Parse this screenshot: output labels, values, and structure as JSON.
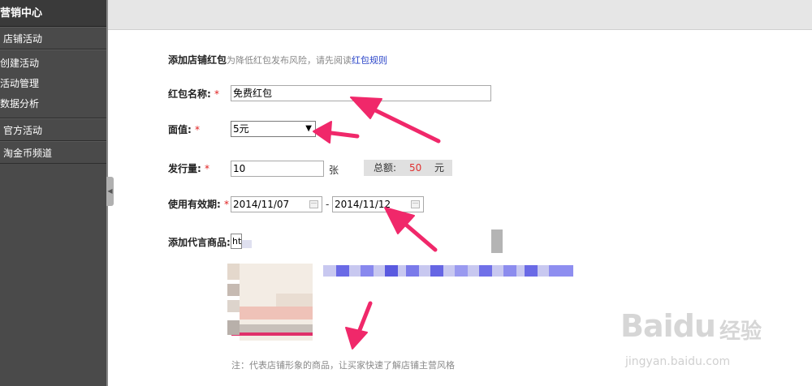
{
  "sidebar": {
    "title": "营销中心",
    "section1": "店铺活动",
    "items": [
      "创建活动",
      "活动管理",
      "数据分析"
    ],
    "section2": "官方活动",
    "section3": "淘金币频道"
  },
  "form": {
    "heading": "添加店铺红包",
    "heading_hint": "为降低红包发布风险，请先阅读",
    "rules_link": "红包规则",
    "name_label": "红包名称:",
    "name_value": "免费红包",
    "face_label": "面值:",
    "face_value": "5元",
    "qty_label": "发行量:",
    "qty_value": "10",
    "qty_unit": "张",
    "total_label": "总额:",
    "total_value": "50",
    "total_unit": "元",
    "validity_label": "使用有效期:",
    "start_date": "2014/11/07",
    "date_sep": "-",
    "end_date": "2014/11/12",
    "product_label": "添加代言商品:",
    "product_value": "ht",
    "required_mark": "*",
    "note": "注：代表店铺形象的商品，让买家快速了解店铺主营风格"
  },
  "watermark": {
    "logo": "Baidu",
    "cn": "经验",
    "url": "jingyan.baidu.com"
  },
  "colors": {
    "accent_link": "#2b45c8",
    "required": "#e02020",
    "arrow": "#f0286a",
    "sidebar_bg": "#4a4a4a"
  }
}
